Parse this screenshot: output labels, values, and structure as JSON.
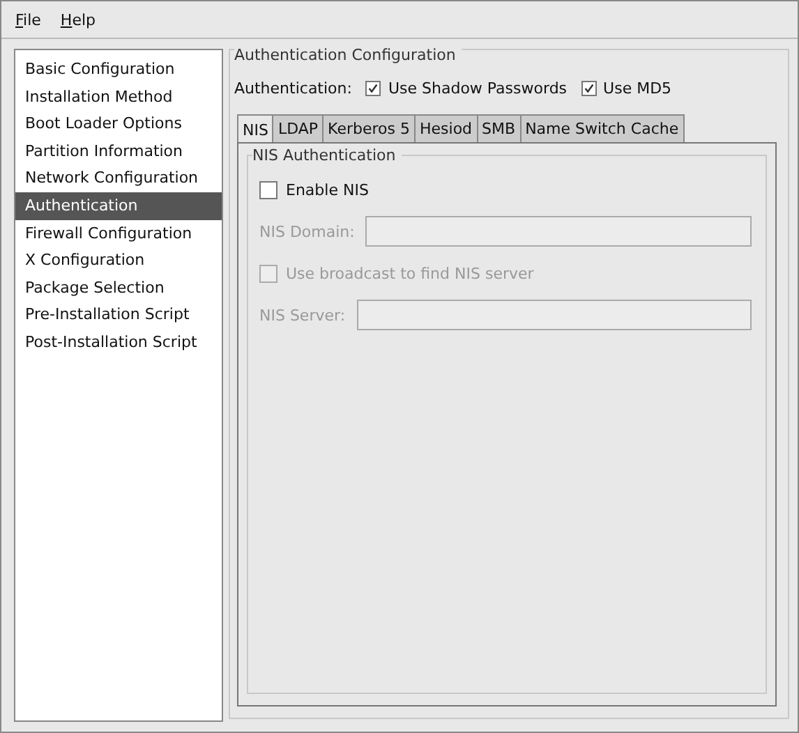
{
  "menu": [
    {
      "label": "File"
    },
    {
      "label": "Help"
    }
  ],
  "sidebar": {
    "items": [
      {
        "label": "Basic Configuration",
        "selected": false
      },
      {
        "label": "Installation Method",
        "selected": false
      },
      {
        "label": "Boot Loader Options",
        "selected": false
      },
      {
        "label": "Partition Information",
        "selected": false
      },
      {
        "label": "Network Configuration",
        "selected": false
      },
      {
        "label": "Authentication",
        "selected": true
      },
      {
        "label": "Firewall Configuration",
        "selected": false
      },
      {
        "label": "X Configuration",
        "selected": false
      },
      {
        "label": "Package Selection",
        "selected": false
      },
      {
        "label": "Pre-Installation Script",
        "selected": false
      },
      {
        "label": "Post-Installation Script",
        "selected": false
      }
    ]
  },
  "panel": {
    "title": "Authentication Configuration",
    "label": "Authentication:",
    "options": [
      {
        "label": "Use Shadow Passwords",
        "checked": true
      },
      {
        "label": "Use MD5",
        "checked": true
      }
    ],
    "tabs": [
      {
        "label": "NIS",
        "selected": true
      },
      {
        "label": "LDAP",
        "selected": false
      },
      {
        "label": "Kerberos 5",
        "selected": false
      },
      {
        "label": "Hesiod",
        "selected": false
      },
      {
        "label": "SMB",
        "selected": false
      },
      {
        "label": "Name Switch Cache",
        "selected": false
      }
    ],
    "group": {
      "title": "NIS Authentication",
      "controls": [
        {
          "kind": "checkbox",
          "label": "Enable NIS",
          "checked": false,
          "disabled": false
        },
        {
          "kind": "field",
          "label": "NIS Domain:",
          "disabled": true
        },
        {
          "kind": "checkbox",
          "label": "Use broadcast to find NIS server",
          "checked": false,
          "disabled": true
        },
        {
          "kind": "field",
          "label": "NIS Server:",
          "disabled": true
        }
      ]
    }
  }
}
